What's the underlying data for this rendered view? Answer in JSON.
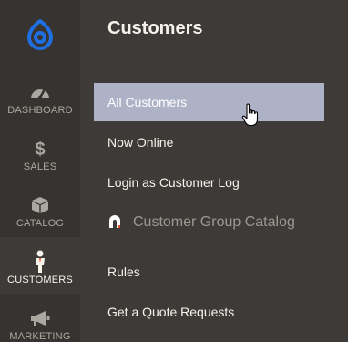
{
  "rail": {
    "items": [
      {
        "label": "DASHBOARD",
        "icon": "speedometer-icon"
      },
      {
        "label": "SALES",
        "icon": "dollar-icon"
      },
      {
        "label": "CATALOG",
        "icon": "box-icon"
      },
      {
        "label": "CUSTOMERS",
        "icon": "person-icon"
      },
      {
        "label": "MARKETING",
        "icon": "megaphone-icon"
      }
    ]
  },
  "panel": {
    "title": "Customers",
    "items": [
      {
        "label": "All Customers"
      },
      {
        "label": "Now Online"
      },
      {
        "label": "Login as Customer Log"
      },
      {
        "label": "Customer Group Catalog"
      },
      {
        "label": "Rules"
      },
      {
        "label": "Get a Quote Requests"
      }
    ]
  },
  "colors": {
    "rail_bg": "#373330",
    "panel_bg": "#3d3a38",
    "selected_bg": "#adb2c6",
    "logo_blue": "#1f6fe0",
    "section_text": "#9d9792"
  }
}
